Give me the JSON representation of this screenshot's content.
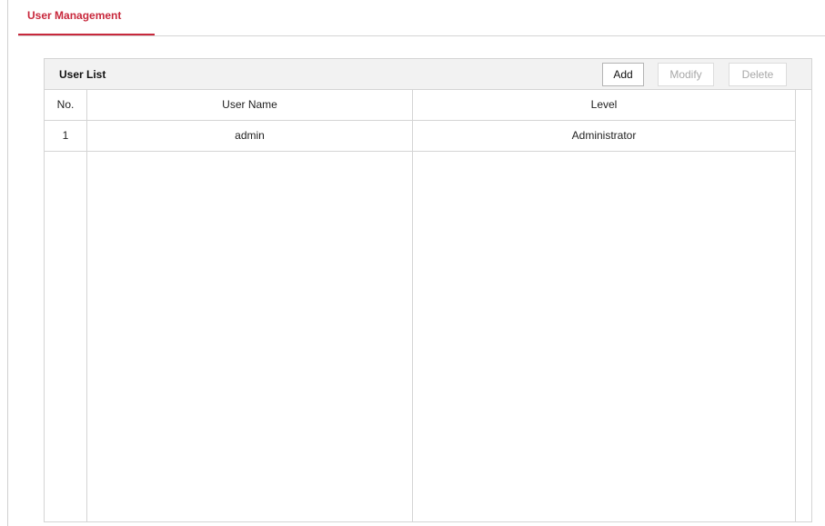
{
  "tab": {
    "label": "User Management"
  },
  "user_list": {
    "title": "User List",
    "buttons": {
      "add": "Add",
      "modify": "Modify",
      "delete": "Delete"
    },
    "columns": [
      "No.",
      "User Name",
      "Level"
    ],
    "rows": [
      {
        "no": "1",
        "user_name": "admin",
        "level": "Administrator"
      }
    ]
  },
  "colors": {
    "accent": "#c8283c",
    "border": "#d4d4d4",
    "header_bg": "#f2f2f2",
    "disabled_text": "#a8a8a8"
  }
}
